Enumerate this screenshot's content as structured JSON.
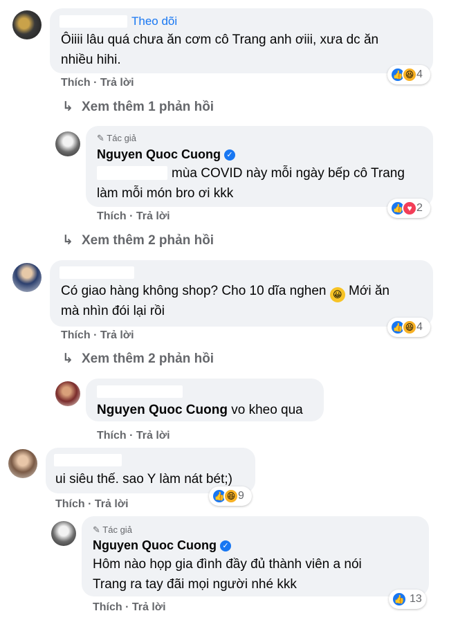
{
  "comments": [
    {
      "follow_label": "Theo dõi",
      "line1": "Ôiiii lâu quá chưa ăn cơm cô Trang anh ơiii, xưa dc ăn",
      "line2": "nhiều hihi.",
      "like_label": "Thích",
      "reply_label": "Trả lời",
      "reaction_count": "4",
      "more_replies": "Xem thêm 1 phản hồi"
    },
    {
      "author_tag": "Tác giả",
      "author_name": "Nguyen Quoc Cuong",
      "line1": "mùa COVID này mỗi ngày bếp cô Trang",
      "line2": "làm mỗi món bro ơi kkk",
      "like_label": "Thích",
      "reply_label": "Trả lời",
      "reaction_count": "2",
      "more_replies": "Xem thêm 2 phản hồi"
    },
    {
      "line1": "Có giao hàng không shop? Cho 10 dĩa nghen",
      "line1_tail": "Mới ăn",
      "line2": "mà nhìn đói lại rồi",
      "like_label": "Thích",
      "reply_label": "Trả lời",
      "reaction_count": "4",
      "more_replies": "Xem thêm 2 phản hồi"
    },
    {
      "mention": "Nguyen Quoc Cuong",
      "text": "vo kheo qua",
      "like_label": "Thích",
      "reply_label": "Trả lời"
    },
    {
      "line1": "ui siêu thế. sao Y làm nát bét;)",
      "like_label": "Thích",
      "reply_label": "Trả lời",
      "reaction_count": "9"
    },
    {
      "author_tag": "Tác giả",
      "author_name": "Nguyen Quoc Cuong",
      "line1": "Hôm nào họp gia đình đầy đủ thành viên a nói",
      "line2": "Trang ra tay đãi mọi người nhé kkk",
      "like_label": "Thích",
      "reply_label": "Trả lời",
      "reaction_count": "13"
    }
  ],
  "icons": {
    "like": "like-icon",
    "haha": "haha-icon",
    "love": "love-icon",
    "reply_arrow": "reply-arrow-icon",
    "pencil": "pencil-icon",
    "verified": "verified-badge-icon",
    "smiley": "smiley-emoji"
  },
  "colors": {
    "bubble": "#f0f2f5",
    "link": "#1877f2",
    "secondary_text": "#65676b",
    "love": "#f33e58",
    "haha": "#f7b125"
  }
}
